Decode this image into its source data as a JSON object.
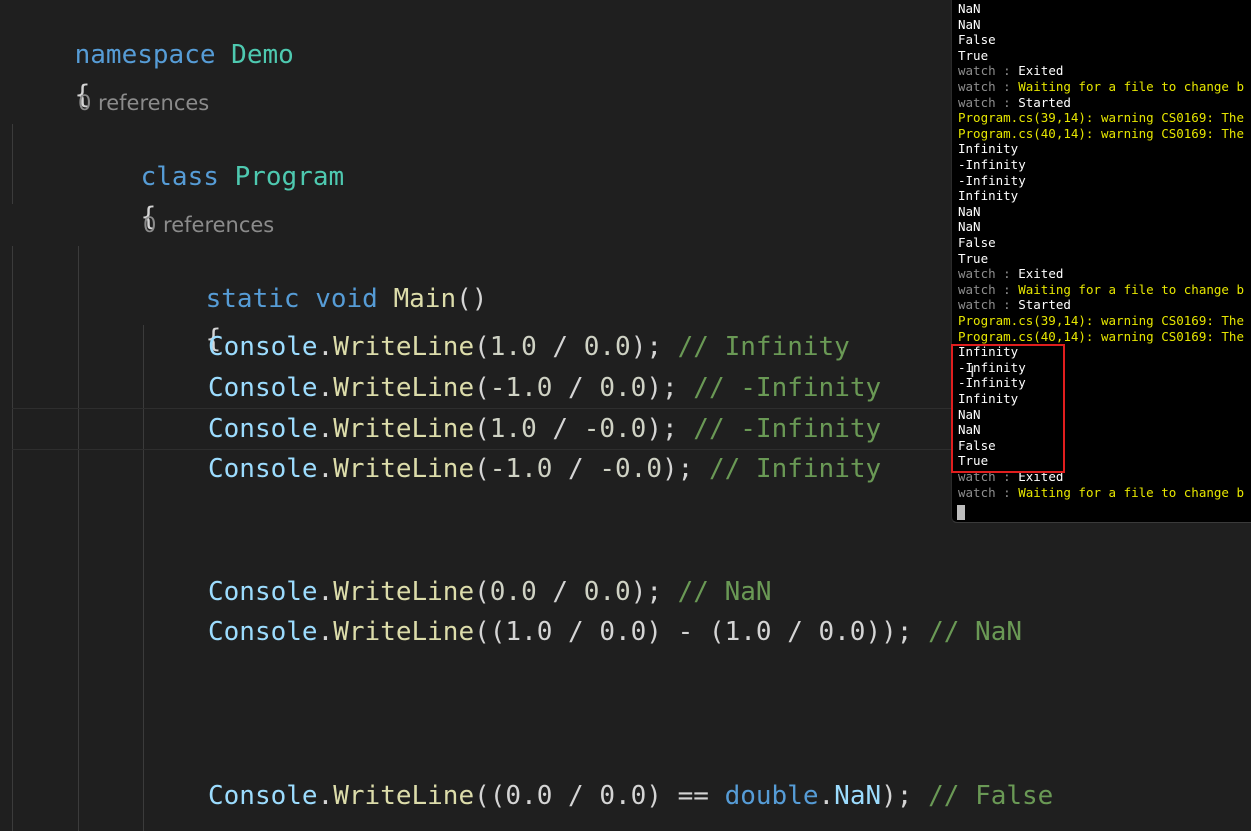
{
  "code": {
    "namespace_keyword": "namespace",
    "namespace_name": "Demo",
    "open_brace": "{",
    "class_codelens": "0 references",
    "class_keyword": "class",
    "class_name": "Program",
    "method_codelens": "0 references",
    "static_keyword": "static",
    "void_keyword": "void",
    "method_name": "Main",
    "method_parens": "()",
    "lines": [
      {
        "prefix": "Console",
        "dot": ".",
        "fn": "WriteLine",
        "open": "(",
        "a": "1.0",
        "op": " / ",
        "b": "0.0",
        "close": ");",
        "comment": " // Infinity"
      },
      {
        "prefix": "Console",
        "dot": ".",
        "fn": "WriteLine",
        "open": "(",
        "a": "-1.0",
        "op": " / ",
        "b": "0.0",
        "close": ");",
        "comment": " // -Infinity"
      },
      {
        "prefix": "Console",
        "dot": ".",
        "fn": "WriteLine",
        "open": "(",
        "a": "1.0",
        "op": " / ",
        "b": "-0.0",
        "close": ");",
        "comment": " // -Infinity"
      },
      {
        "prefix": "Console",
        "dot": ".",
        "fn": "WriteLine",
        "open": "(",
        "a": "-1.0",
        "op": " / ",
        "b": "-0.0",
        "close": ");",
        "comment": " // Infinity"
      },
      {
        "prefix": "Console",
        "dot": ".",
        "fn": "WriteLine",
        "open": "(",
        "a": "0.0",
        "op": " / ",
        "b": "0.0",
        "close": ");",
        "comment": " // NaN"
      }
    ],
    "nan_line": {
      "prefix": "Console",
      "dot": ".",
      "fn": "WriteLine",
      "body": "((1.0 / 0.0) - (1.0 / 0.0));",
      "comment": " // NaN"
    },
    "eq_line": {
      "prefix": "Console",
      "dot": ".",
      "fn": "WriteLine",
      "body1": "((0.0 / 0.0) ",
      "eq": "==",
      "sp": " ",
      "dbl": "double",
      "dot2": ".",
      "nan": "NaN",
      "body2": ");",
      "comment": " // False"
    }
  },
  "terminal": {
    "lines": [
      {
        "parts": [
          {
            "t": "NaN",
            "c": "white"
          }
        ]
      },
      {
        "parts": [
          {
            "t": "NaN",
            "c": "white"
          }
        ]
      },
      {
        "parts": [
          {
            "t": "False",
            "c": "white"
          }
        ]
      },
      {
        "parts": [
          {
            "t": "True",
            "c": "white"
          }
        ]
      },
      {
        "parts": [
          {
            "t": "watch : ",
            "c": "gray"
          },
          {
            "t": "Exited",
            "c": "white"
          }
        ]
      },
      {
        "parts": [
          {
            "t": "watch : ",
            "c": "gray"
          },
          {
            "t": "Waiting for a file to change b",
            "c": "yellow"
          }
        ]
      },
      {
        "parts": [
          {
            "t": "watch : ",
            "c": "gray"
          },
          {
            "t": "Started",
            "c": "white"
          }
        ]
      },
      {
        "parts": [
          {
            "t": "Program.cs(39,14): warning CS0169: The",
            "c": "yellow"
          }
        ]
      },
      {
        "parts": [
          {
            "t": "Program.cs(40,14): warning CS0169: The",
            "c": "yellow"
          }
        ]
      },
      {
        "parts": [
          {
            "t": "Infinity",
            "c": "white"
          }
        ]
      },
      {
        "parts": [
          {
            "t": "-Infinity",
            "c": "white"
          }
        ]
      },
      {
        "parts": [
          {
            "t": "-Infinity",
            "c": "white"
          }
        ]
      },
      {
        "parts": [
          {
            "t": "Infinity",
            "c": "white"
          }
        ]
      },
      {
        "parts": [
          {
            "t": "NaN",
            "c": "white"
          }
        ]
      },
      {
        "parts": [
          {
            "t": "NaN",
            "c": "white"
          }
        ]
      },
      {
        "parts": [
          {
            "t": "False",
            "c": "white"
          }
        ]
      },
      {
        "parts": [
          {
            "t": "True",
            "c": "white"
          }
        ]
      },
      {
        "parts": [
          {
            "t": "watch : ",
            "c": "gray"
          },
          {
            "t": "Exited",
            "c": "white"
          }
        ]
      },
      {
        "parts": [
          {
            "t": "watch : ",
            "c": "gray"
          },
          {
            "t": "Waiting for a file to change b",
            "c": "yellow"
          }
        ]
      },
      {
        "parts": [
          {
            "t": "watch : ",
            "c": "gray"
          },
          {
            "t": "Started",
            "c": "white"
          }
        ]
      },
      {
        "parts": [
          {
            "t": "Program.cs(39,14): warning CS0169: The",
            "c": "yellow"
          }
        ]
      },
      {
        "parts": [
          {
            "t": "Program.cs(40,14): warning CS0169: The",
            "c": "yellow"
          }
        ]
      },
      {
        "parts": [
          {
            "t": "Infinity",
            "c": "white"
          }
        ]
      },
      {
        "parts": [
          {
            "t": "-Infinity",
            "c": "white"
          }
        ]
      },
      {
        "parts": [
          {
            "t": "-Infinity",
            "c": "white"
          }
        ]
      },
      {
        "parts": [
          {
            "t": "Infinity",
            "c": "white"
          }
        ]
      },
      {
        "parts": [
          {
            "t": "NaN",
            "c": "white"
          }
        ]
      },
      {
        "parts": [
          {
            "t": "NaN",
            "c": "white"
          }
        ]
      },
      {
        "parts": [
          {
            "t": "False",
            "c": "white"
          }
        ]
      },
      {
        "parts": [
          {
            "t": "True",
            "c": "white"
          }
        ]
      },
      {
        "parts": [
          {
            "t": "watch : ",
            "c": "gray"
          },
          {
            "t": "Exited",
            "c": "white"
          }
        ]
      },
      {
        "parts": [
          {
            "t": "watch : ",
            "c": "gray"
          },
          {
            "t": "Waiting for a file to change b",
            "c": "yellow"
          }
        ]
      }
    ]
  },
  "colors": {
    "keyword": "#569cd6",
    "type": "#4ec9b0",
    "function": "#dcdcaa",
    "comment": "#6a9955",
    "terminal_yellow": "#e6e600",
    "highlight_red": "#e01e1e"
  },
  "icons": {
    "text_cursor": "ibeam-cursor-icon"
  }
}
